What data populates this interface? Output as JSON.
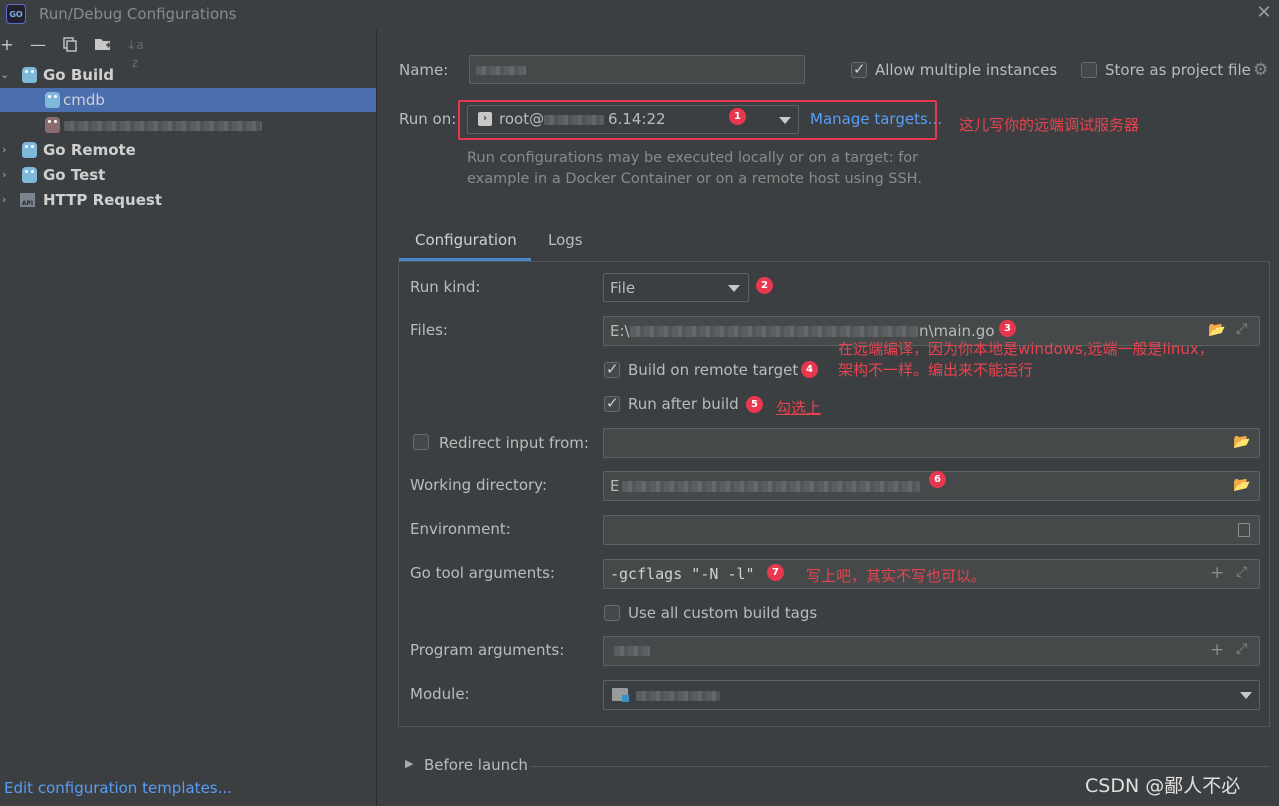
{
  "window": {
    "title": "Run/Debug Configurations",
    "app_icon_text": "GO"
  },
  "toolbar": {
    "icons": [
      "add-icon",
      "remove-icon",
      "copy-icon",
      "folder-add-icon",
      "sort-icon"
    ],
    "add": "+",
    "remove": "—",
    "sort": "↓a z"
  },
  "tree": {
    "go_build": "Go Build",
    "cmdb": "cmdb",
    "go_remote": "Go Remote",
    "go_test": "Go Test",
    "http_request": "HTTP Request",
    "api_badge": "API"
  },
  "left_footer": {
    "templates_link": "Edit configuration templates..."
  },
  "form": {
    "name_label": "Name:",
    "allow_multiple": "Allow multiple instances",
    "store_as_project": "Store as project file",
    "run_on_label": "Run on:",
    "run_on_value_prefix": "root@",
    "run_on_value_suffix": "6.14:22",
    "manage_targets": "Manage targets...",
    "run_on_hint_1": "Run configurations may be executed locally or on a target: for",
    "run_on_hint_2": "example in a Docker Container or on a remote host using SSH."
  },
  "tabs": {
    "configuration": "Configuration",
    "logs": "Logs"
  },
  "config": {
    "run_kind_label": "Run kind:",
    "run_kind_value": "File",
    "files_label": "Files:",
    "files_prefix": "E:\\",
    "files_suffix": "n\\main.go",
    "build_remote": "Build on remote target",
    "run_after_build": "Run after build",
    "redirect_label": "Redirect input from:",
    "workdir_label": "Working directory:",
    "workdir_prefix": "E",
    "env_label": "Environment:",
    "go_tool_label": "Go tool arguments:",
    "go_tool_value": "-gcflags \"-N -l\"",
    "custom_tags": "Use all custom build tags",
    "program_args_label": "Program arguments:",
    "module_label": "Module:",
    "before_launch": "Before launch"
  },
  "annotations": {
    "n1": "1",
    "n2": "2",
    "n3": "3",
    "n4": "4",
    "n5": "5",
    "n6": "6",
    "n7": "7",
    "remote_server": "这儿写你的远端调试服务器",
    "compile_1": "在远端编译，因为你本地是windows,远端一般是linux，",
    "compile_2": "架构不一样。编出来不能运行",
    "check_it": "勾选上",
    "write_it": "写上吧，其实不写也可以。"
  },
  "watermark": "CSDN @鄙人不必",
  "colors": {
    "annotation_red": "#e8384f",
    "link_blue": "#589df6",
    "selection": "#4b6eaf",
    "tab_accent": "#4a88c7"
  }
}
